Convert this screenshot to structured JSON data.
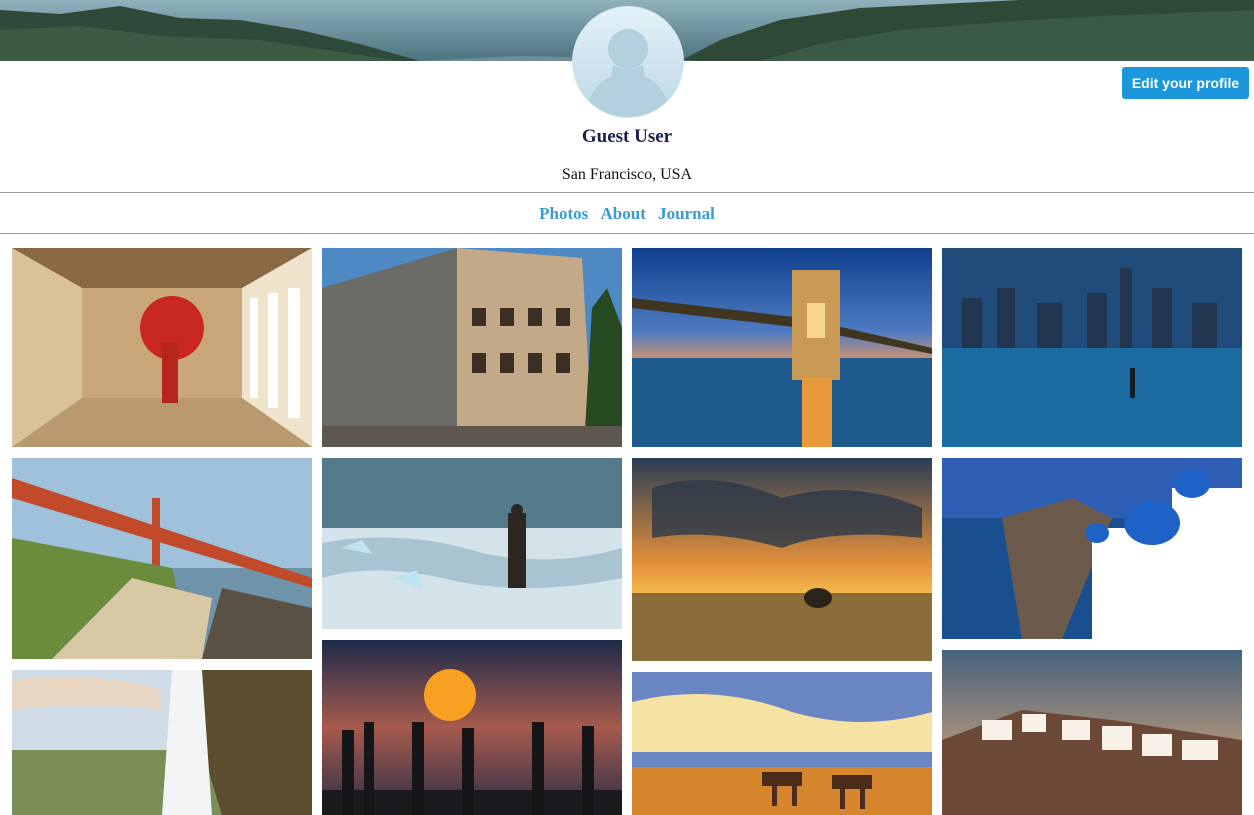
{
  "profile": {
    "name": "Guest User",
    "location": "San Francisco, USA",
    "edit_label": "Edit your profile"
  },
  "tabs": [
    {
      "label": "Photos"
    },
    {
      "label": "About"
    },
    {
      "label": "Journal"
    }
  ],
  "colors": {
    "accent": "#1c97dc",
    "tab_link": "#3a9bd2",
    "name_text": "#1a1f4e"
  },
  "icons": {
    "avatar": "default-user-silhouette-icon"
  },
  "photos": [
    {
      "subject": "red-umbrella-corridor"
    },
    {
      "subject": "colosseum"
    },
    {
      "subject": "chain-bridge-night"
    },
    {
      "subject": "city-skyline-night"
    },
    {
      "subject": "golden-gate-bridge"
    },
    {
      "subject": "photographer-icy-beach"
    },
    {
      "subject": "savanna-sunset-elephant"
    },
    {
      "subject": "santorini-blue-domes"
    },
    {
      "subject": "waterfall-cave"
    },
    {
      "subject": "monks-sunset-bridge"
    },
    {
      "subject": "desert-camel-caravan"
    },
    {
      "subject": "santorini-village-aerial"
    }
  ]
}
